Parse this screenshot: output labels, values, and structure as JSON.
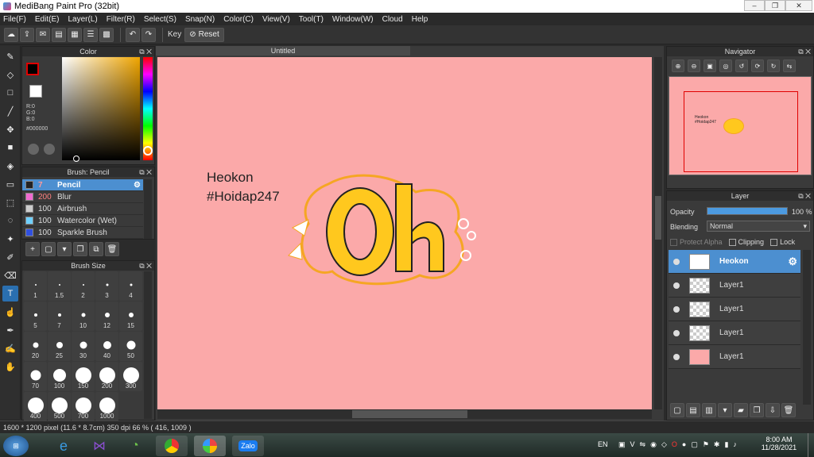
{
  "window": {
    "title": "MediBang Paint Pro (32bit)"
  },
  "menu": [
    "File(F)",
    "Edit(E)",
    "Layer(L)",
    "Filter(R)",
    "Select(S)",
    "Snap(N)",
    "Color(C)",
    "View(V)",
    "Tool(T)",
    "Window(W)",
    "Cloud",
    "Help"
  ],
  "toolbar": {
    "key_label": "Key",
    "reset_label": "Reset"
  },
  "color_panel": {
    "title": "Color",
    "r": "R:0",
    "g": "G:0",
    "b": "B:0",
    "hex": "#000000",
    "fg_color": "#000000",
    "bg_color": "#ffffff"
  },
  "brush_panel": {
    "title": "Brush: Pencil",
    "items": [
      {
        "size": "7",
        "name": "Pencil",
        "color": "#222222"
      },
      {
        "size": "200",
        "name": "Blur",
        "color": "#f06ad0"
      },
      {
        "size": "100",
        "name": "Airbrush",
        "color": "#cccccc"
      },
      {
        "size": "100",
        "name": "Watercolor (Wet)",
        "color": "#6fd0ff"
      },
      {
        "size": "100",
        "name": "Sparkle Brush",
        "color": "#3050e0"
      }
    ]
  },
  "brush_size_panel": {
    "title": "Brush Size",
    "sizes": [
      "1",
      "1.5",
      "2",
      "3",
      "4",
      "5",
      "7",
      "10",
      "12",
      "15",
      "20",
      "25",
      "30",
      "40",
      "50",
      "70",
      "100",
      "150",
      "200",
      "300",
      "400",
      "500",
      "700",
      "1000"
    ]
  },
  "document": {
    "tab": "Untitled"
  },
  "canvas": {
    "text_line1": "Heokon",
    "text_line2": "#Hoidap247",
    "artwork_text": "Oh",
    "background": "#fba9a9"
  },
  "navigator": {
    "title": "Navigator"
  },
  "layer_panel": {
    "title": "Layer",
    "opacity_label": "Opacity",
    "opacity_value": "100 %",
    "opacity": 1.0,
    "blending_label": "Blending",
    "blending_value": "Normal",
    "protect_alpha": "Protect Alpha",
    "clipping": "Clipping",
    "lock": "Lock",
    "layers": [
      {
        "name": "Heokon",
        "selected": true
      },
      {
        "name": "Layer1",
        "selected": false
      },
      {
        "name": "Layer1",
        "selected": false
      },
      {
        "name": "Layer1",
        "selected": false
      },
      {
        "name": "Layer1",
        "selected": false
      }
    ]
  },
  "status": {
    "size": "1600 * 1200 pixel",
    "physical": "(11.6 * 8.7cm)",
    "dpi": "350 dpi",
    "zoom": "66 %",
    "coords": "( 416, 1009 )"
  },
  "taskbar": {
    "lang": "EN",
    "time": "8:00 AM",
    "date": "11/28/2021",
    "zalo": "Zalo"
  }
}
